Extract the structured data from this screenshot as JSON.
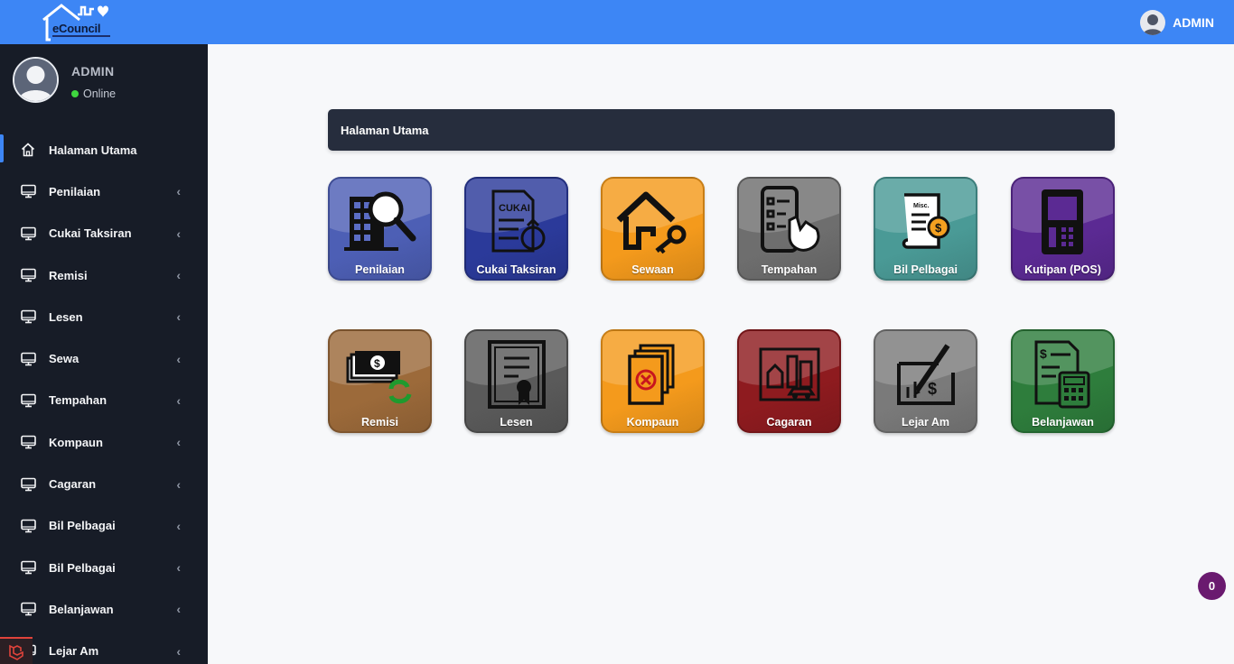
{
  "app": {
    "logo_text": "eCouncil"
  },
  "topbar": {
    "user_name": "ADMIN"
  },
  "sidebar": {
    "user": {
      "name": "ADMIN",
      "status": "Online"
    },
    "items": [
      {
        "label": "Halaman Utama",
        "icon": "home-icon",
        "active": true,
        "expandable": false
      },
      {
        "label": "Penilaian",
        "icon": "monitor-icon",
        "expandable": true
      },
      {
        "label": "Cukai Taksiran",
        "icon": "monitor-icon",
        "expandable": true
      },
      {
        "label": "Remisi",
        "icon": "monitor-icon",
        "expandable": true
      },
      {
        "label": "Lesen",
        "icon": "monitor-icon",
        "expandable": true
      },
      {
        "label": "Sewa",
        "icon": "monitor-icon",
        "expandable": true
      },
      {
        "label": "Tempahan",
        "icon": "monitor-icon",
        "expandable": true
      },
      {
        "label": "Kompaun",
        "icon": "monitor-icon",
        "expandable": true
      },
      {
        "label": "Cagaran",
        "icon": "monitor-icon",
        "expandable": true
      },
      {
        "label": "Bil Pelbagai",
        "icon": "monitor-icon",
        "expandable": true
      },
      {
        "label": "Bil Pelbagai",
        "icon": "monitor-icon",
        "expandable": true
      },
      {
        "label": "Belanjawan",
        "icon": "monitor-icon",
        "expandable": true
      },
      {
        "label": "Lejar Am",
        "icon": "monitor-icon",
        "expandable": true
      }
    ]
  },
  "main": {
    "breadcrumb": "Halaman Utama",
    "tiles": [
      {
        "label": "Penilaian",
        "color": "#4d5fb5",
        "icon": "building-search-icon",
        "icon_text": ""
      },
      {
        "label": "Cukai Taksiran",
        "color": "#2b3a9a",
        "icon": "tax-document-icon",
        "icon_text": "CUKAI"
      },
      {
        "label": "Sewaan",
        "color": "#f49a1c",
        "icon": "house-key-icon",
        "icon_text": ""
      },
      {
        "label": "Tempahan",
        "color": "#6e6e6e",
        "icon": "phone-booking-icon",
        "icon_text": ""
      },
      {
        "label": "Bil Pelbagai",
        "color": "#4a9a96",
        "icon": "misc-bill-icon",
        "icon_text": "Misc."
      },
      {
        "label": "Kutipan (POS)",
        "color": "#5b2a93",
        "icon": "pos-terminal-icon",
        "icon_text": ""
      },
      {
        "label": "Remisi",
        "color": "#9c6a3a",
        "icon": "money-refund-icon",
        "icon_text": ""
      },
      {
        "label": "Lesen",
        "color": "#5a5a5a",
        "icon": "license-certificate-icon",
        "icon_text": ""
      },
      {
        "label": "Kompaun",
        "color": "#f49a1c",
        "icon": "compound-notice-icon",
        "icon_text": ""
      },
      {
        "label": "Cagaran",
        "color": "#8e1b1f",
        "icon": "collateral-city-icon",
        "icon_text": ""
      },
      {
        "label": "Lejar Am",
        "color": "#7a7a7a",
        "icon": "ledger-icon",
        "icon_text": ""
      },
      {
        "label": "Belanjawan",
        "color": "#2e7d3c",
        "icon": "budget-calculator-icon",
        "icon_text": ""
      }
    ]
  },
  "notification_count": "0"
}
